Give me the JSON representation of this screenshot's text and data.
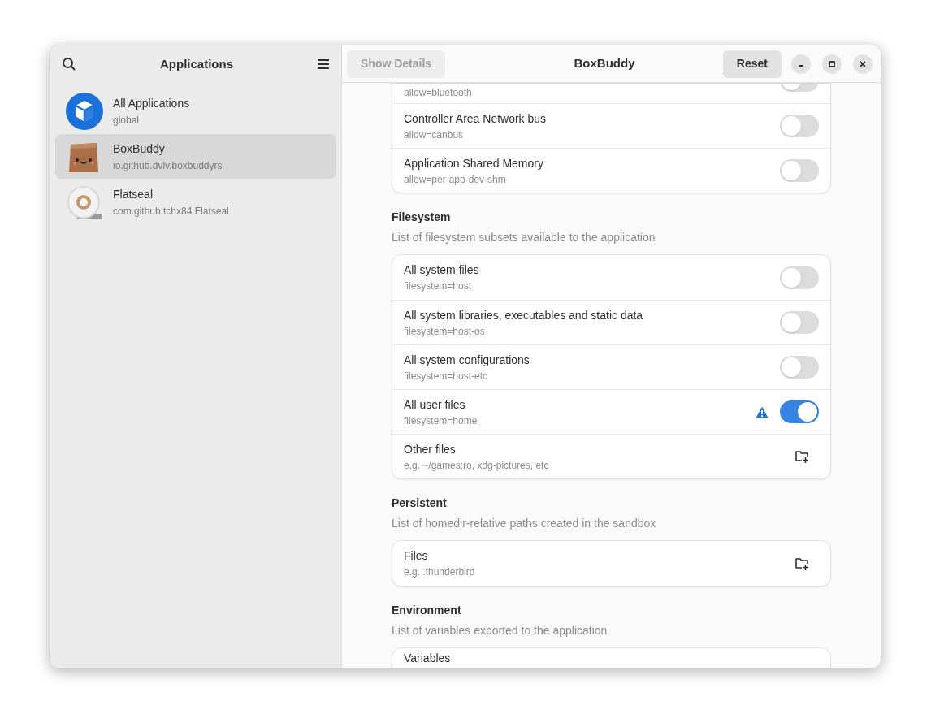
{
  "sidebar": {
    "title": "Applications",
    "items": [
      {
        "name": "All Applications",
        "id": "global",
        "selected": false
      },
      {
        "name": "BoxBuddy",
        "id": "io.github.dvlv.boxbuddyrs",
        "selected": true
      },
      {
        "name": "Flatseal",
        "id": "com.github.tchx84.Flatseal",
        "selected": false
      }
    ]
  },
  "header": {
    "details_button": "Show Details",
    "title": "BoxBuddy",
    "reset_button": "Reset"
  },
  "top_card": {
    "rows": [
      {
        "kind": "partial",
        "subtitle": "allow=bluetooth",
        "on": false
      },
      {
        "kind": "toggle",
        "title": "Controller Area Network bus",
        "subtitle": "allow=canbus",
        "on": false
      },
      {
        "kind": "toggle",
        "title": "Application Shared Memory",
        "subtitle": "allow=per-app-dev-shm",
        "on": false
      }
    ]
  },
  "sections": [
    {
      "title": "Filesystem",
      "description": "List of filesystem subsets available to the application",
      "rows": [
        {
          "kind": "toggle",
          "title": "All system files",
          "subtitle": "filesystem=host",
          "on": false,
          "warning": false
        },
        {
          "kind": "toggle",
          "title": "All system libraries, executables and static data",
          "subtitle": "filesystem=host-os",
          "on": false,
          "warning": false
        },
        {
          "kind": "toggle",
          "title": "All system configurations",
          "subtitle": "filesystem=host-etc",
          "on": false,
          "warning": false
        },
        {
          "kind": "toggle",
          "title": "All user files",
          "subtitle": "filesystem=home",
          "on": true,
          "warning": true
        },
        {
          "kind": "add",
          "title": "Other files",
          "subtitle": "e.g. ~/games:ro, xdg-pictures, etc"
        }
      ]
    },
    {
      "title": "Persistent",
      "description": "List of homedir-relative paths created in the sandbox",
      "rows": [
        {
          "kind": "add",
          "title": "Files",
          "subtitle": "e.g. .thunderbird"
        }
      ]
    },
    {
      "title": "Environment",
      "description": "List of variables exported to the application",
      "rows": [
        {
          "kind": "cut",
          "title": "Variables"
        }
      ]
    }
  ]
}
